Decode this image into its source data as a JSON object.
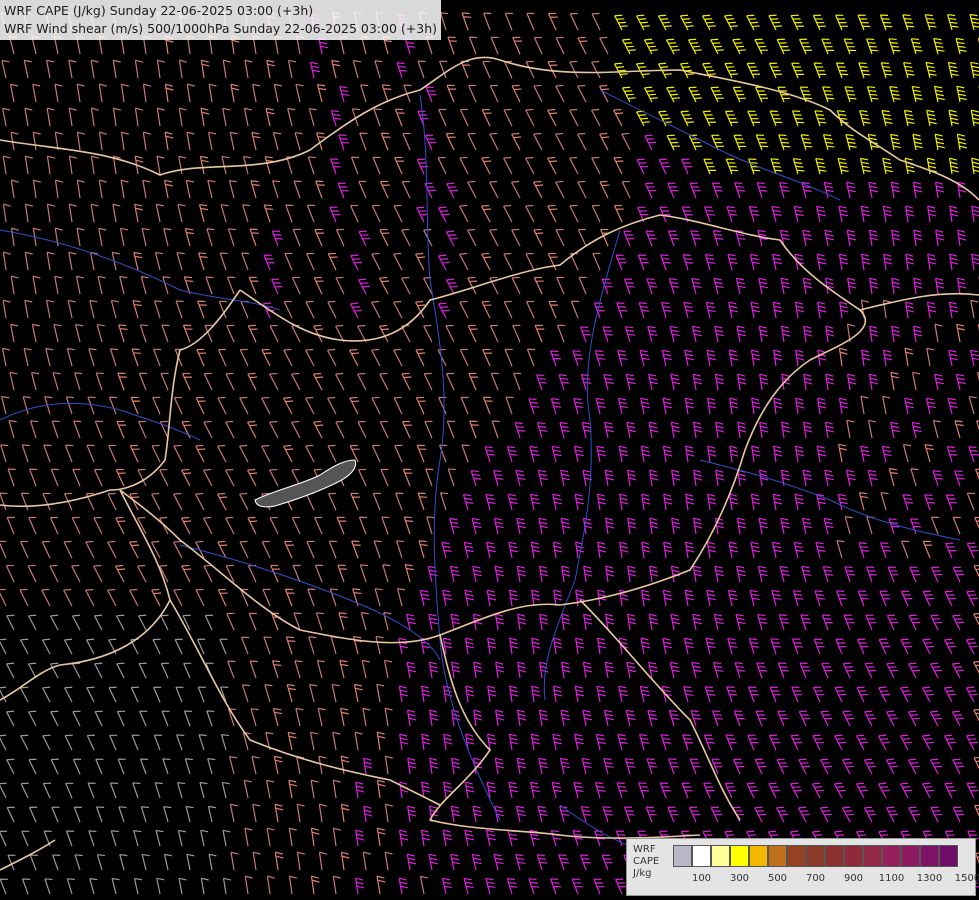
{
  "titles": [
    "WRF CAPE (J/kg) Sunday 22-06-2025 03:00 (+3h)",
    "WRF Wind shear (m/s) 500/1000hPa Sunday 22-06-2025 03:00 (+3h)"
  ],
  "legend": {
    "name_lines": [
      "WRF",
      "CAPE",
      "J/kg"
    ],
    "colors": [
      "#b8b8c8",
      "#ffffff",
      "#ffff99",
      "#ffff00",
      "#f5b800",
      "#c0701c",
      "#944220",
      "#8b3a2a",
      "#8b3030",
      "#8e2a3a",
      "#922848",
      "#96205a",
      "#8c1a60",
      "#7e1266",
      "#700c6a"
    ],
    "tick_labels": [
      "100",
      "300",
      "500",
      "700",
      "900",
      "1100",
      "1300",
      "1500"
    ]
  },
  "colors": {
    "weak_shear": "#9a9a9a",
    "moderate_shear": "#c87878",
    "moderate_high_shear": "#e08070",
    "high_shear": "#e020e0",
    "very_high_shear": "#f0f000",
    "borders": "#e8c8a0",
    "rivers": "#3050c8",
    "lakes": "#ffffff"
  }
}
